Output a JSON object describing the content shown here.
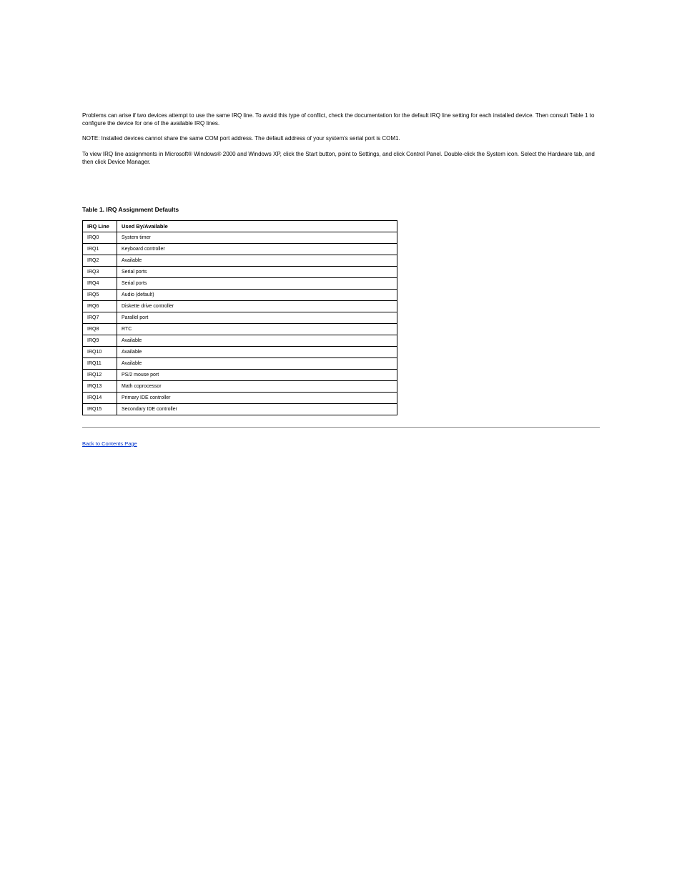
{
  "intro_paragraphs": [
    "Problems can arise if two devices attempt to use the same IRQ line. To avoid this type of conflict, check the documentation for the default IRQ line setting for each installed device. Then consult Table 1 to configure the device for one of the available IRQ lines.",
    "NOTE: Installed devices cannot share the same COM port address. The default address of your system's serial port is COM1.",
    "To view IRQ line assignments in Microsoft® Windows® 2000 and Windows XP, click the Start button, point to Settings, and click Control Panel. Double-click the System icon. Select the Hardware tab, and then click Device Manager."
  ],
  "table_heading": {
    "prefix": "Table",
    "title": "1. IRQ Assignment Defaults"
  },
  "table": {
    "columns": [
      "IRQ Line",
      "Used By/Available"
    ],
    "rows": [
      [
        "IRQ0",
        "System timer"
      ],
      [
        "IRQ1",
        "Keyboard controller"
      ],
      [
        "IRQ2",
        "Available"
      ],
      [
        "IRQ3",
        "Serial ports"
      ],
      [
        "IRQ4",
        "Serial ports"
      ],
      [
        "IRQ5",
        "Audio (default)"
      ],
      [
        "IRQ6",
        "Diskette drive controller"
      ],
      [
        "IRQ7",
        "Parallel port"
      ],
      [
        "IRQ8",
        "RTC"
      ],
      [
        "IRQ9",
        "Available"
      ],
      [
        "IRQ10",
        "Available"
      ],
      [
        "IRQ11",
        "Available"
      ],
      [
        "IRQ12",
        "PS/2 mouse port"
      ],
      [
        "IRQ13",
        "Math coprocessor"
      ],
      [
        "IRQ14",
        "Primary IDE controller"
      ],
      [
        "IRQ15",
        "Secondary IDE controller"
      ]
    ]
  },
  "back_link": "Back to Contents Page"
}
